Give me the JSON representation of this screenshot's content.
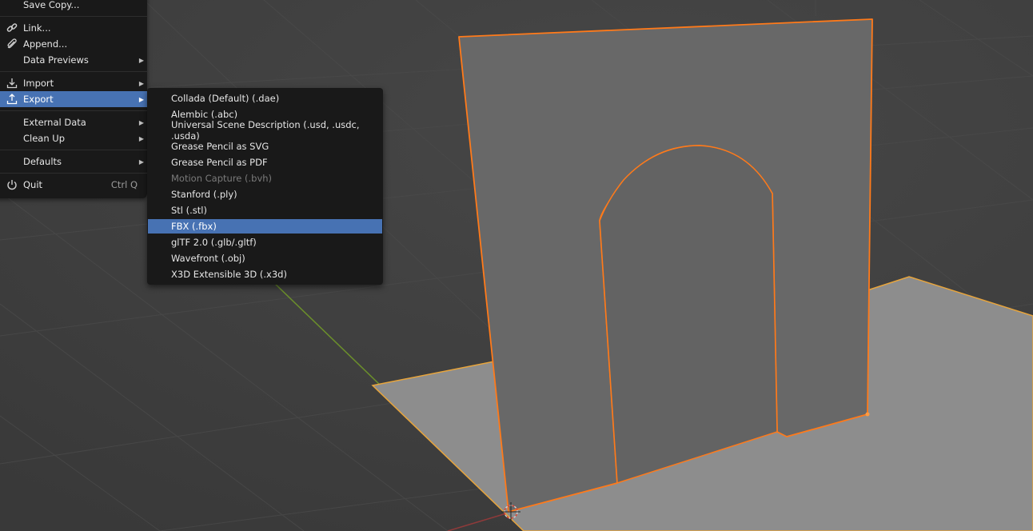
{
  "colors": {
    "menu_bg": "#191919",
    "highlight": "#4772b3",
    "selection_outline": "#ff7a1a",
    "viewport_bg": "#3d3d3d"
  },
  "file_menu": {
    "save_copy": "Save Copy...",
    "link": "Link...",
    "append": "Append...",
    "data_previews": "Data Previews",
    "import": "Import",
    "export": "Export",
    "external_data": "External Data",
    "clean_up": "Clean Up",
    "defaults": "Defaults",
    "quit": "Quit",
    "quit_shortcut": "Ctrl Q"
  },
  "export_menu": {
    "items": [
      "Collada (Default) (.dae)",
      "Alembic (.abc)",
      "Universal Scene Description (.usd, .usdc, .usda)",
      "Grease Pencil as SVG",
      "Grease Pencil as PDF",
      "Motion Capture (.bvh)",
      "Stanford (.ply)",
      "Stl (.stl)",
      "FBX (.fbx)",
      "glTF 2.0 (.glb/.gltf)",
      "Wavefront (.obj)",
      "X3D Extensible 3D (.x3d)"
    ],
    "disabled_item": "Motion Capture (.bvh)",
    "highlighted_item": "FBX (.fbx)"
  }
}
